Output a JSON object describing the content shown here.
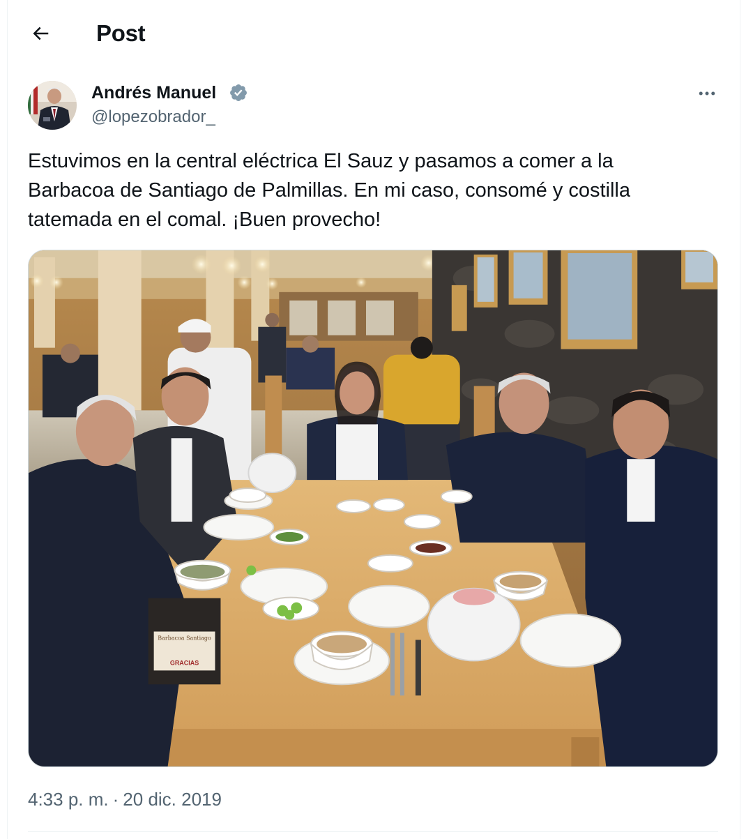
{
  "header": {
    "title": "Post",
    "back_icon": "arrow-left-icon"
  },
  "author": {
    "name": "Andrés Manuel",
    "handle": "@lopezobrador_",
    "verified": true,
    "verified_color": "#829aab"
  },
  "tweet": {
    "text": "Estuvimos en la central eléctrica El Sauz y pasamos a comer a la\nBarbacoa de Santiago de Palmillas. En mi caso, consomé y costilla\ntatemada en el comal. ¡Buen provecho!",
    "time": "4:33 p. m.",
    "separator": "·",
    "date": "20 dic. 2019"
  },
  "photo": {
    "icon": "photo-restaurant-table"
  },
  "sign_text": {
    "line1": "Barbacoa Santiago",
    "line2": "GRACIAS"
  },
  "colors": {
    "text_primary": "#0f1419",
    "text_secondary": "#536471",
    "border": "#eff3f4"
  }
}
